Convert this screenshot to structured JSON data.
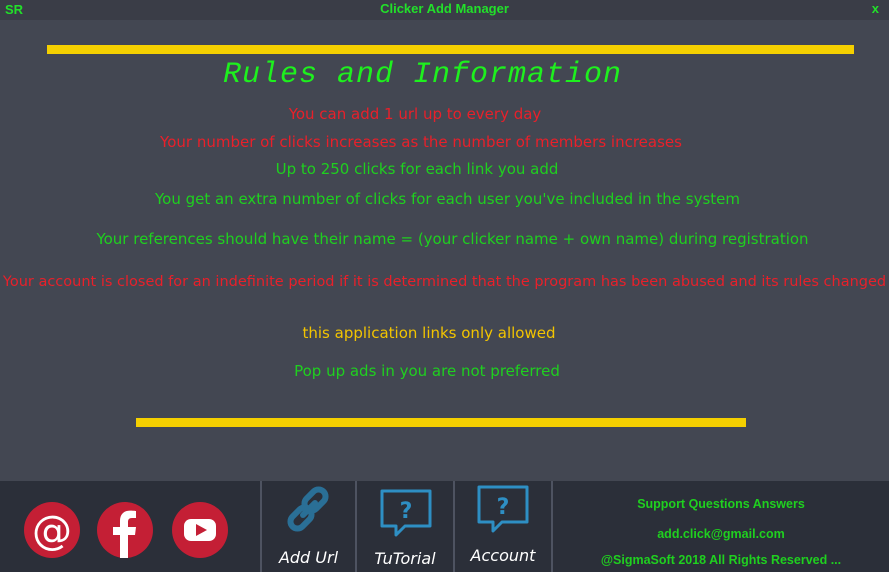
{
  "window": {
    "logo_text": "SR",
    "title": "Clicker Add Manager",
    "close_label": "x"
  },
  "main": {
    "heading": "Rules and Information",
    "rules": [
      "You can add 1 url up to  every day",
      "Your number of clicks increases as the number of members increases",
      "Up to 250 clicks for each link you add",
      "You get an extra number of clicks for each user you've included in the system",
      "Your references should have their name = (your clicker name + own name) during registration",
      "Your account is closed for an indefinite period if it is determined that the program has been abused and its rules changed",
      "this application links only allowed",
      "Pop up ads in you are not preferred"
    ]
  },
  "footer": {
    "social": [
      {
        "icon": "at-icon"
      },
      {
        "icon": "facebook-icon"
      },
      {
        "icon": "youtube-icon"
      }
    ],
    "tiles": [
      {
        "label": "Add Url",
        "icon": "link-icon"
      },
      {
        "label": "TuTorial",
        "icon": "question-chat-icon"
      },
      {
        "label": "Account",
        "icon": "question-chat-icon"
      }
    ],
    "support": {
      "title": "Support Questions  Answers",
      "email": "add.click@gmail.com",
      "copyright": "@SigmaSoft 2018 All Rights Reserved ..."
    }
  },
  "colors": {
    "background": "#434752",
    "footer": "#2b2f39",
    "accent_green": "#1fd01f",
    "accent_red": "#e8202a",
    "accent_yellow": "#f5d000",
    "social_red": "#c41f35",
    "icon_blue": "#2e8fc4"
  }
}
